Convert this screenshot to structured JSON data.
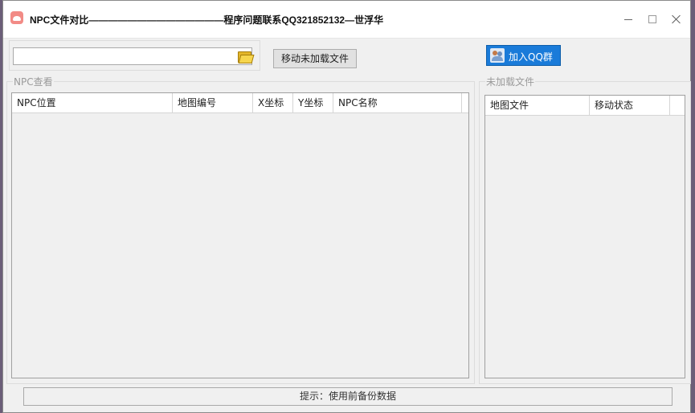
{
  "window": {
    "title": "NPC文件对比——————————————程序问题联系QQ321852132—世浮华",
    "app_icon": "cloud-app-icon"
  },
  "toolbar": {
    "path_value": "",
    "move_button_label": "移动未加载文件",
    "qq_button_label": "加入QQ群",
    "qq_button_color": "#1a7bd9"
  },
  "npc_panel": {
    "label": "NPC查看",
    "columns": [
      "NPC位置",
      "地图编号",
      "X坐标",
      "Y坐标",
      "NPC名称"
    ]
  },
  "unloaded_panel": {
    "label": "未加载文件",
    "columns": [
      "地图文件",
      "移动状态"
    ]
  },
  "status": {
    "hint": "提示：使用前备份数据"
  }
}
